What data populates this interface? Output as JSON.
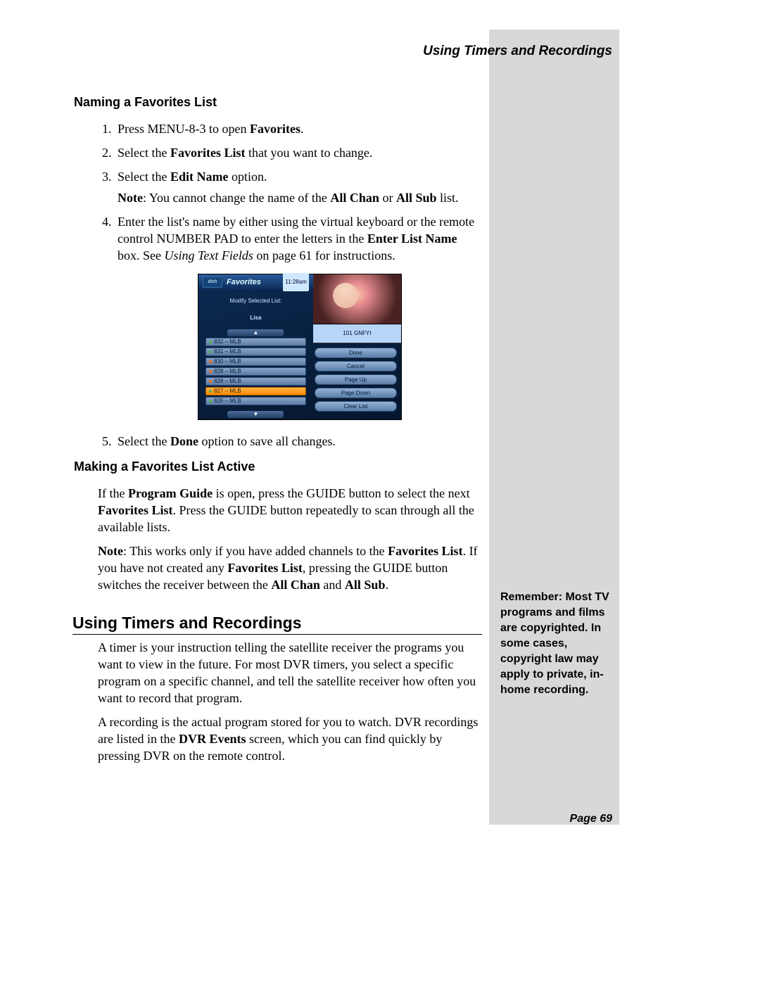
{
  "running_head": "Using Timers and Recordings",
  "page_label": "Page 69",
  "section1": {
    "title": "Naming a Favorites List",
    "steps": {
      "s1_a": "Press ",
      "s1_b": "MENU-8-3",
      "s1_c": " to open ",
      "s1_d": "Favorites",
      "s1_e": ".",
      "s2_a": "Select the ",
      "s2_b": "Favorites List",
      "s2_c": " that you want to change.",
      "s3_a": "Select the ",
      "s3_b": "Edit Name",
      "s3_c": " option.",
      "s3n_a": "Note",
      "s3n_b": ": You cannot change the name of the ",
      "s3n_c": "All Chan",
      "s3n_d": " or ",
      "s3n_e": "All Sub",
      "s3n_f": " list.",
      "s4_a": "Enter the list's name by either using the virtual keyboard or the remote control ",
      "s4_b": "NUMBER PAD",
      "s4_c": " to enter the letters in the ",
      "s4_d": "Enter List Name",
      "s4_e": " box. See ",
      "s4_f": "Using Text Fields",
      "s4_g": " on page 61 for instructions.",
      "s5_a": "Select the ",
      "s5_b": "Done",
      "s5_c": " option to save all changes."
    }
  },
  "section2": {
    "title": "Making a Favorites List Active",
    "p1_a": "If the ",
    "p1_b": "Program Guide",
    "p1_c": " is open, press the ",
    "p1_d": "GUIDE",
    "p1_e": " button to select the next ",
    "p1_f": "Favorites List",
    "p1_g": ". Press the ",
    "p1_h": "GUIDE",
    "p1_i": " button repeatedly to scan through all the available lists.",
    "p2_a": "Note",
    "p2_b": ": This works only if you have added channels to the ",
    "p2_c": "Favorites List",
    "p2_d": ". If you have not created any ",
    "p2_e": "Favorites List",
    "p2_f": ", pressing the ",
    "p2_g": "GUIDE",
    "p2_h": " button switches the receiver between the ",
    "p2_i": "All Chan",
    "p2_j": " and ",
    "p2_k": "All Sub",
    "p2_l": "."
  },
  "section3": {
    "title": "Using Timers and Recordings",
    "p1": "A timer is your instruction telling the satellite receiver the programs you want to view in the future. For most DVR timers, you select a specific program on a specific channel, and tell the satellite receiver how often you want to record that program.",
    "p2_a": "A recording is the actual program stored for you to watch. DVR recordings are listed in the ",
    "p2_b": "DVR Events",
    "p2_c": " screen, which you can find quickly by pressing ",
    "p2_d": "DVR",
    "p2_e": " on the remote control."
  },
  "sidebar_note": "Remember: Most TV programs and films are copyrighted. In some cases, copyright law may apply to private, in-home recording.",
  "tv": {
    "logo": "dish",
    "title": "Favorites",
    "time": "11:28am",
    "modify_label": "Modify Selected List:",
    "modify_name": "Lisa",
    "scroll_up": "▲",
    "scroll_down": "▼",
    "pip_label": "101 GNFYI",
    "rows": {
      "r0": "832 – MLB",
      "r1": "831 – MLB",
      "r2": "830 – MLB",
      "r3": "829 – MLB",
      "r4": "828 – MLB",
      "r5": "827 – MLB",
      "r6": "826 – MLB"
    },
    "buttons": {
      "b0": "Done",
      "b1": "Cancel",
      "b2": "Page Up",
      "b3": "Page Down",
      "b4": "Clear List"
    }
  }
}
